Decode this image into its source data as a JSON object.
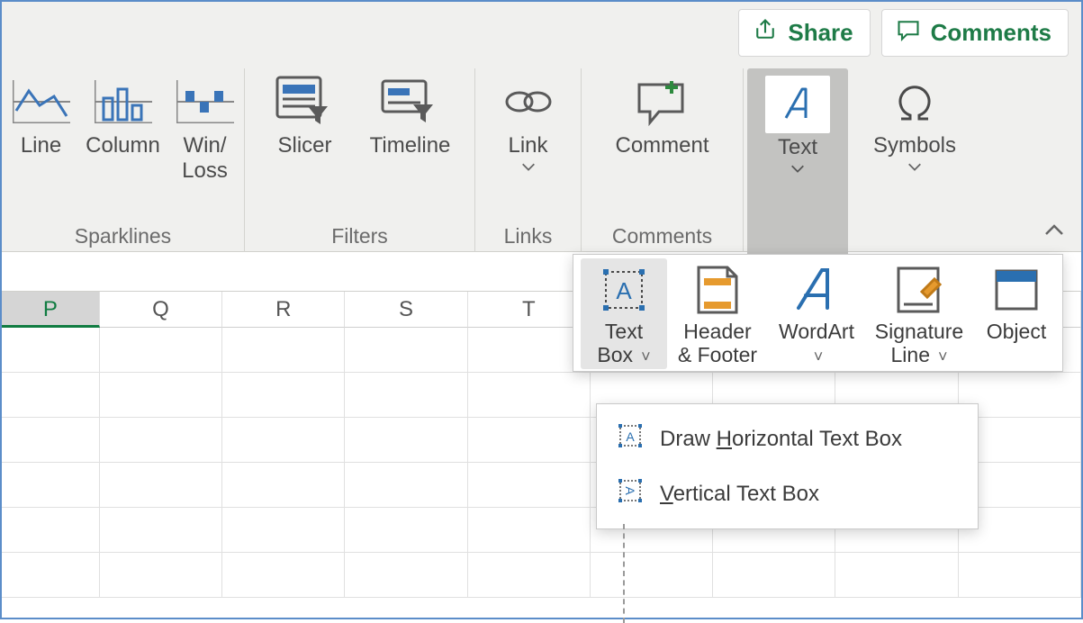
{
  "top": {
    "share": "Share",
    "comments": "Comments"
  },
  "ribbon": {
    "groups": {
      "sparklines": {
        "title": "Sparklines",
        "line": "Line",
        "column": "Column",
        "winloss": "Win/\nLoss"
      },
      "filters": {
        "title": "Filters",
        "slicer": "Slicer",
        "timeline": "Timeline"
      },
      "links": {
        "title": "Links",
        "link": "Link"
      },
      "comments": {
        "title": "Comments",
        "comment": "Comment"
      },
      "text": {
        "label": "Text"
      },
      "symbols": {
        "label": "Symbols"
      }
    }
  },
  "columns": [
    "P",
    "Q",
    "R",
    "S",
    "T"
  ],
  "popover": {
    "textbox": "Text\nBox",
    "header_footer": "Header\n& Footer",
    "wordart": "WordArt",
    "signature_line": "Signature\nLine",
    "object": "Object"
  },
  "menu": {
    "horizontal_prefix": "Draw ",
    "horizontal_ul": "H",
    "horizontal_suffix": "orizontal Text Box",
    "vertical_ul": "V",
    "vertical_suffix": "ertical Text Box"
  }
}
